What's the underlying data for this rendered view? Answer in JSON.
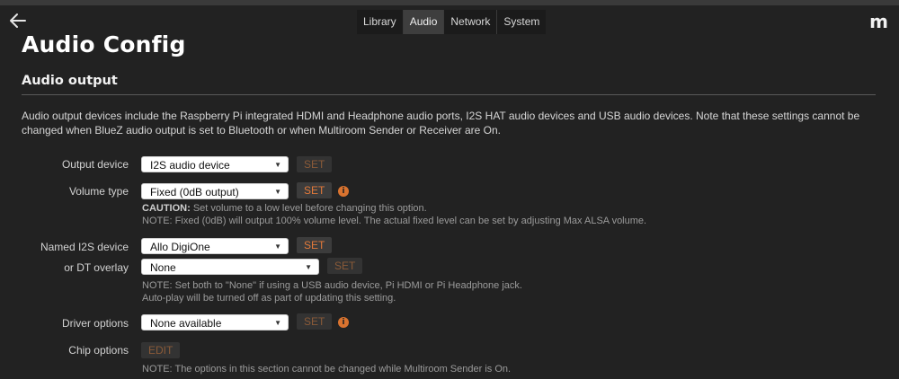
{
  "nav": {
    "tabs": [
      {
        "label": "Library"
      },
      {
        "label": "Audio"
      },
      {
        "label": "Network"
      },
      {
        "label": "System"
      }
    ],
    "logo": "m"
  },
  "page_title": "Audio Config",
  "section": {
    "title": "Audio output",
    "description": "Audio output devices include the Raspberry Pi integrated HDMI and Headphone audio ports, I2S HAT audio devices and USB audio devices. Note that these settings cannot be changed when BlueZ audio output is set to Bluetooth or when Multiroom Sender or Receiver are On."
  },
  "rows": {
    "output_device": {
      "label": "Output device",
      "value": "I2S audio device",
      "button": "SET"
    },
    "volume_type": {
      "label": "Volume type",
      "value": "Fixed (0dB output)",
      "button": "SET",
      "caution_label": "CAUTION:",
      "caution_text": " Set volume to a low level before changing this option.",
      "note": "NOTE: Fixed (0dB) will output 100% volume level. The actual fixed level can be set by adjusting Max ALSA volume."
    },
    "named_i2s": {
      "label": "Named I2S device",
      "value": "Allo DigiOne",
      "button": "SET"
    },
    "dt_overlay": {
      "label": "or DT overlay",
      "value": "None",
      "button": "SET",
      "note1": "NOTE: Set both to \"None\" if using a USB audio device, Pi HDMI or Pi Headphone jack.",
      "note2": "Auto-play will be turned off as part of updating this setting."
    },
    "driver_options": {
      "label": "Driver options",
      "value": "None available",
      "button": "SET"
    },
    "chip_options": {
      "label": "Chip options",
      "button": "EDIT",
      "note": "NOTE: The options in this section cannot be changed while Multiroom Sender is On."
    }
  },
  "colors": {
    "background": "#222222",
    "accent": "#e2793a"
  },
  "icons": {
    "back": "arrow-left-icon",
    "info": "info-icon",
    "dropdown": "chevron-down-icon"
  }
}
